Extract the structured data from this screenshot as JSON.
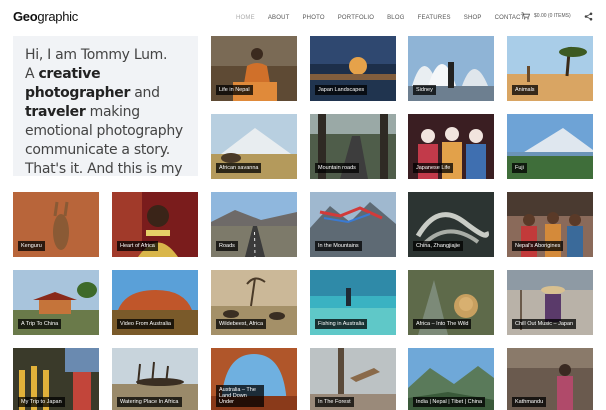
{
  "header": {
    "logo_bold": "Geo",
    "logo_rest": "graphic",
    "nav": [
      "HOME",
      "ABOUT",
      "PHOTO",
      "PORTFOLIO",
      "BLOG",
      "FEATURES",
      "SHOP",
      "CONTACT"
    ],
    "cart_label": "$0.00 (0 ITEMS)"
  },
  "intro": {
    "line1": "Hi, I am Tommy Lum.",
    "a": "A ",
    "creative": "creative photographer",
    "and": "and ",
    "traveler": "traveler",
    "rest": " making emotional photography communicate a story. That's it. And this is my"
  },
  "tiles": [
    {
      "caption": "Life in Nepal"
    },
    {
      "caption": "Japan Landscapes"
    },
    {
      "caption": "Sidney"
    },
    {
      "caption": "Animals"
    },
    {
      "caption": "African savanna"
    },
    {
      "caption": "Mountain roads"
    },
    {
      "caption": "Japanese Life"
    },
    {
      "caption": "Fuji"
    },
    {
      "caption": "Kenguru"
    },
    {
      "caption": "Heart of Africa"
    },
    {
      "caption": "Roads"
    },
    {
      "caption": "In the Mountains"
    },
    {
      "caption": "China, Zhangjiajie"
    },
    {
      "caption": "Nepal's Aborigines"
    },
    {
      "caption": "A Trip To China"
    },
    {
      "caption": "Video From Australia"
    },
    {
      "caption": "Wildebeest, Africa"
    },
    {
      "caption": "Fishing in Australia"
    },
    {
      "caption": "Africa – Into The Wild"
    },
    {
      "caption": "Chill Out Music – Japan"
    },
    {
      "caption": "My Trip to Japan"
    },
    {
      "caption": "Watering Place In Africa"
    },
    {
      "caption": "Australia – The Land Down Under"
    },
    {
      "caption": "In The Forest"
    },
    {
      "caption": "India | Nepal | Tibet | China"
    },
    {
      "caption": "Kathmandu"
    }
  ]
}
